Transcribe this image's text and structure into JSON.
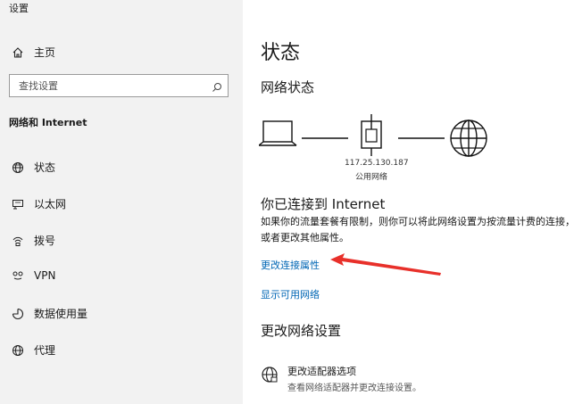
{
  "app_title": "设置",
  "sidebar": {
    "home_label": "主页",
    "search_placeholder": "查找设置",
    "section_label": "网络和 Internet",
    "items": [
      {
        "label": "状态",
        "icon": "globe-icon"
      },
      {
        "label": "以太网",
        "icon": "ethernet-icon"
      },
      {
        "label": "拨号",
        "icon": "dialup-icon"
      },
      {
        "label": "VPN",
        "icon": "vpn-icon"
      },
      {
        "label": "数据使用量",
        "icon": "data-usage-icon"
      },
      {
        "label": "代理",
        "icon": "proxy-globe-icon"
      }
    ]
  },
  "main": {
    "title": "状态",
    "network_status_title": "网络状态",
    "ip_address": "117.25.130.187",
    "network_type": "公用网络",
    "connected_title": "你已连接到 Internet",
    "connected_desc": "如果你的流量套餐有限制，则你可以将此网络设置为按流量计费的连接，或者更改其他属性。",
    "link_change_props": "更改连接属性",
    "link_show_networks": "显示可用网络",
    "change_settings_title": "更改网络设置",
    "adapter_title": "更改适配器选项",
    "adapter_desc": "查看网络适配器并更改连接设置。"
  },
  "colors": {
    "sidebar_bg": "#f2f2f2",
    "link": "#0066b4",
    "annotation_arrow": "#e8302a"
  }
}
